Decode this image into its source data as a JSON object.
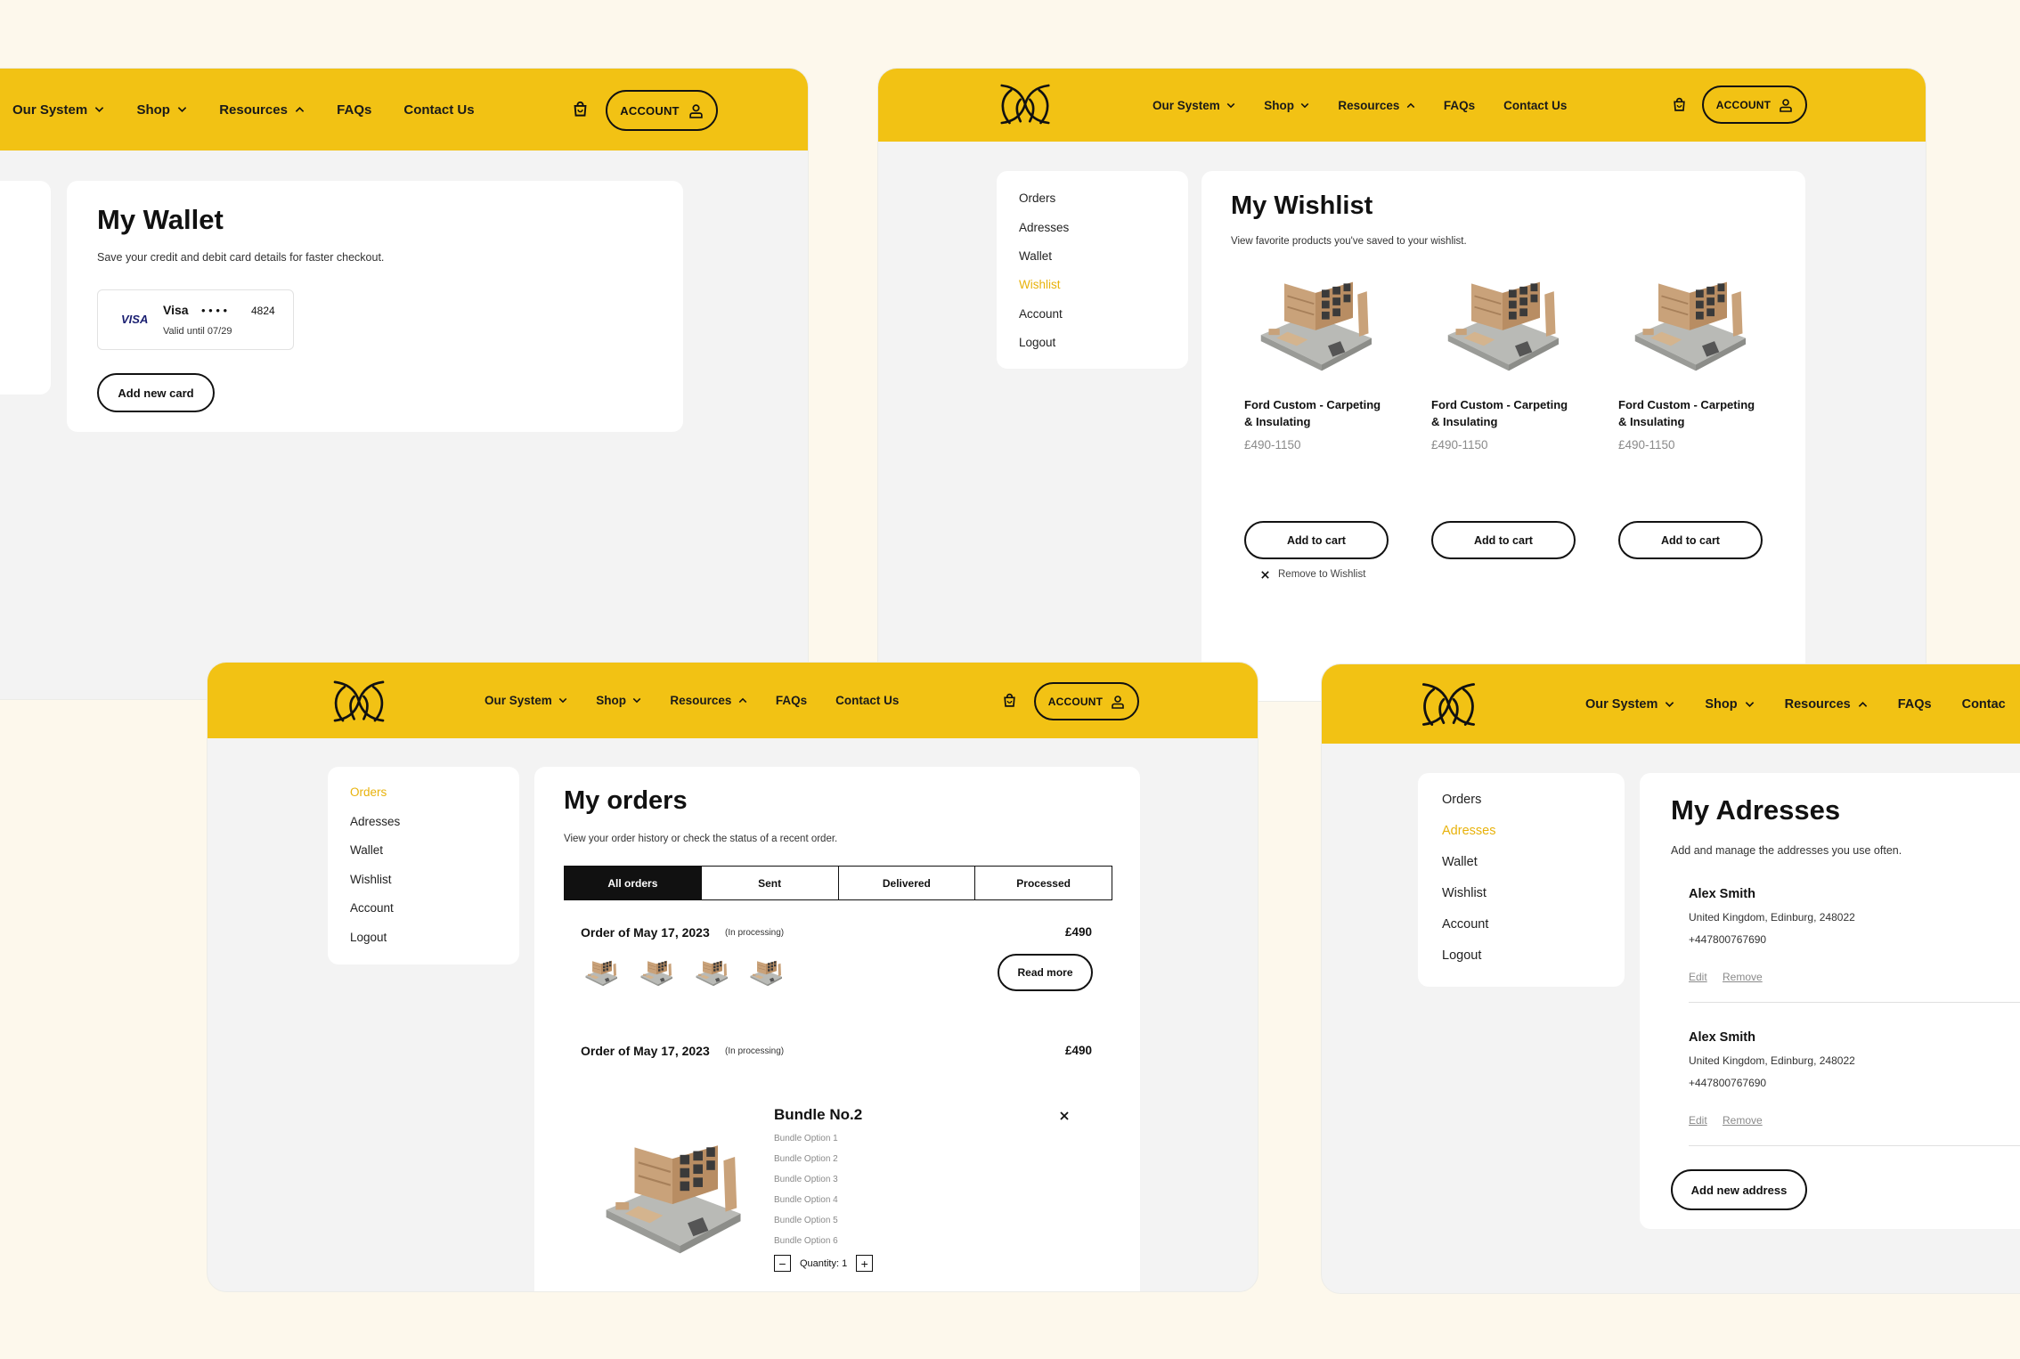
{
  "nav": {
    "items": [
      "Our System",
      "Shop",
      "Resources",
      "FAQs",
      "Contact Us"
    ],
    "items_clipped": [
      "Our System",
      "Shop",
      "Resources",
      "FAQs",
      "Contac"
    ],
    "account_label": "ACCOUNT"
  },
  "sidebar": {
    "items": [
      "Orders",
      "Adresses",
      "Wallet",
      "Wishlist",
      "Account",
      "Logout"
    ]
  },
  "wallet": {
    "title": "My Wallet",
    "subtitle": "Save your credit and debit card details for faster checkout.",
    "card_brand_logo": "VISA",
    "card_name": "Visa",
    "card_dots": "• • • •",
    "card_last4": "4824",
    "card_valid": "Valid until 07/29",
    "add_card_label": "Add new card"
  },
  "wishlist": {
    "title": "My Wishlist",
    "subtitle": "View favorite products you've saved to your wishlist.",
    "products": [
      {
        "name_line1": "Ford Custom - Carpeting",
        "name_line2": "& Insulating",
        "price": "£490-1150",
        "button": "Add to cart"
      },
      {
        "name_line1": "Ford Custom - Carpeting",
        "name_line2": "& Insulating",
        "price": "£490-1150",
        "button": "Add to cart"
      },
      {
        "name_line1": "Ford Custom - Carpeting",
        "name_line2": "& Insulating",
        "price": "£490-1150",
        "button": "Add to cart"
      }
    ],
    "remove_label": "Remove to Wishlist"
  },
  "orders": {
    "title": "My orders",
    "subtitle": "View your order history or check the status of a recent order.",
    "tabs": [
      "All orders",
      "Sent",
      "Delivered",
      "Processed"
    ],
    "active_tab": "All orders",
    "order1": {
      "title": "Order of May 17, 2023",
      "status": "(In processing)",
      "price": "£490",
      "button": "Read more"
    },
    "order2": {
      "title": "Order of May 17, 2023",
      "status": "(In processing)",
      "price": "£490"
    },
    "bundle": {
      "name": "Bundle No.2",
      "options": [
        "Bundle Option 1",
        "Bundle Option 2",
        "Bundle Option 3",
        "Bundle Option 4",
        "Bundle Option 5",
        "Bundle Option 6"
      ],
      "quantity_label": "Quantity: 1"
    }
  },
  "addresses": {
    "title": "My Adresses",
    "subtitle": "Add and manage the addresses you use often.",
    "entries": [
      {
        "name": "Alex Smith",
        "address": "United Kingdom, Edinburg, 248022",
        "phone": "+447800767690",
        "edit": "Edit",
        "remove": "Remove"
      },
      {
        "name": "Alex Smith",
        "address": "United Kingdom, Edinburg, 248022",
        "phone": "+447800767690",
        "edit": "Edit",
        "remove": "Remove"
      }
    ],
    "add_label": "Add new address"
  },
  "colors": {
    "background": "#fdf8ec",
    "header_yellow": "#f2c214",
    "active_link": "#e8b20b",
    "panel_bg": "#f3f3f3",
    "text_dark": "#111111"
  },
  "icons": [
    "chevron-down-icon",
    "chevron-up-icon",
    "cart-icon",
    "user-icon",
    "close-icon",
    "minus-icon",
    "plus-icon",
    "visa-logo",
    "brand-logo"
  ]
}
